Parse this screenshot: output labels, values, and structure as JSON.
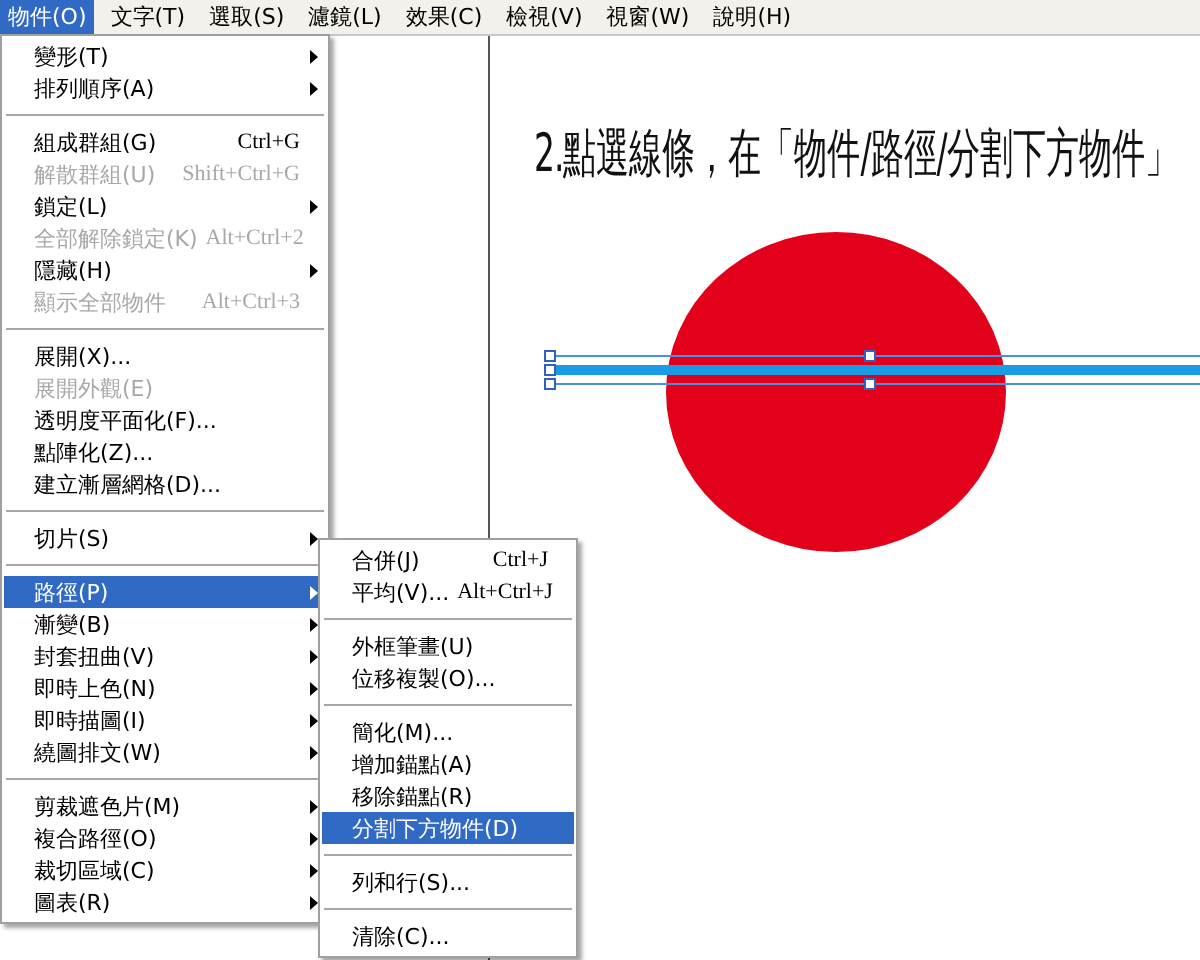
{
  "menubar": [
    {
      "label": "物件(O)",
      "selected": true
    },
    {
      "label": "文字(T)",
      "selected": false
    },
    {
      "label": "選取(S)",
      "selected": false
    },
    {
      "label": "濾鏡(L)",
      "selected": false
    },
    {
      "label": "效果(C)",
      "selected": false
    },
    {
      "label": "檢視(V)",
      "selected": false
    },
    {
      "label": "視窗(W)",
      "selected": false
    },
    {
      "label": "說明(H)",
      "selected": false
    }
  ],
  "object_menu": [
    {
      "kind": "item",
      "label": "變形(T)",
      "submenu": true,
      "disabled": false,
      "selected": false
    },
    {
      "kind": "item",
      "label": "排列順序(A)",
      "submenu": true,
      "disabled": false,
      "selected": false
    },
    {
      "kind": "separator"
    },
    {
      "kind": "item",
      "label": "組成群組(G)",
      "shortcut": "Ctrl+G",
      "submenu": false,
      "disabled": false,
      "selected": false
    },
    {
      "kind": "item",
      "label": "解散群組(U)",
      "shortcut": "Shift+Ctrl+G",
      "submenu": false,
      "disabled": true,
      "selected": false
    },
    {
      "kind": "item",
      "label": "鎖定(L)",
      "submenu": true,
      "disabled": false,
      "selected": false
    },
    {
      "kind": "item",
      "label": "全部解除鎖定(K)",
      "shortcut": "Alt+Ctrl+2",
      "submenu": false,
      "disabled": true,
      "selected": false
    },
    {
      "kind": "item",
      "label": "隱藏(H)",
      "submenu": true,
      "disabled": false,
      "selected": false
    },
    {
      "kind": "item",
      "label": "顯示全部物件",
      "shortcut": "Alt+Ctrl+3",
      "submenu": false,
      "disabled": true,
      "selected": false
    },
    {
      "kind": "separator"
    },
    {
      "kind": "item",
      "label": "展開(X)...",
      "submenu": false,
      "disabled": false,
      "selected": false
    },
    {
      "kind": "item",
      "label": "展開外觀(E)",
      "submenu": false,
      "disabled": true,
      "selected": false
    },
    {
      "kind": "item",
      "label": "透明度平面化(F)...",
      "submenu": false,
      "disabled": false,
      "selected": false
    },
    {
      "kind": "item",
      "label": "點陣化(Z)...",
      "submenu": false,
      "disabled": false,
      "selected": false
    },
    {
      "kind": "item",
      "label": "建立漸層網格(D)...",
      "submenu": false,
      "disabled": false,
      "selected": false
    },
    {
      "kind": "separator"
    },
    {
      "kind": "item",
      "label": "切片(S)",
      "submenu": true,
      "disabled": false,
      "selected": false
    },
    {
      "kind": "separator"
    },
    {
      "kind": "item",
      "label": "路徑(P)",
      "submenu": true,
      "disabled": false,
      "selected": true
    },
    {
      "kind": "item",
      "label": "漸變(B)",
      "submenu": true,
      "disabled": false,
      "selected": false
    },
    {
      "kind": "item",
      "label": "封套扭曲(V)",
      "submenu": true,
      "disabled": false,
      "selected": false
    },
    {
      "kind": "item",
      "label": "即時上色(N)",
      "submenu": true,
      "disabled": false,
      "selected": false
    },
    {
      "kind": "item",
      "label": "即時描圖(I)",
      "submenu": true,
      "disabled": false,
      "selected": false
    },
    {
      "kind": "item",
      "label": "繞圖排文(W)",
      "submenu": true,
      "disabled": false,
      "selected": false
    },
    {
      "kind": "separator"
    },
    {
      "kind": "item",
      "label": "剪裁遮色片(M)",
      "submenu": true,
      "disabled": false,
      "selected": false
    },
    {
      "kind": "item",
      "label": "複合路徑(O)",
      "submenu": true,
      "disabled": false,
      "selected": false
    },
    {
      "kind": "item",
      "label": "裁切區域(C)",
      "submenu": true,
      "disabled": false,
      "selected": false
    },
    {
      "kind": "item",
      "label": "圖表(R)",
      "submenu": true,
      "disabled": false,
      "selected": false
    }
  ],
  "path_submenu": [
    {
      "kind": "item",
      "label": "合併(J)",
      "shortcut": "Ctrl+J",
      "submenu": false,
      "disabled": false,
      "selected": false
    },
    {
      "kind": "item",
      "label": "平均(V)...",
      "shortcut": "Alt+Ctrl+J",
      "submenu": false,
      "disabled": false,
      "selected": false
    },
    {
      "kind": "separator"
    },
    {
      "kind": "item",
      "label": "外框筆畫(U)",
      "submenu": false,
      "disabled": false,
      "selected": false
    },
    {
      "kind": "item",
      "label": "位移複製(O)...",
      "submenu": false,
      "disabled": false,
      "selected": false
    },
    {
      "kind": "separator"
    },
    {
      "kind": "item",
      "label": "簡化(M)...",
      "submenu": false,
      "disabled": false,
      "selected": false
    },
    {
      "kind": "item",
      "label": "增加錨點(A)",
      "submenu": false,
      "disabled": false,
      "selected": false
    },
    {
      "kind": "item",
      "label": "移除錨點(R)",
      "submenu": false,
      "disabled": false,
      "selected": false
    },
    {
      "kind": "item",
      "label": "分割下方物件(D)",
      "submenu": false,
      "disabled": false,
      "selected": true
    },
    {
      "kind": "separator"
    },
    {
      "kind": "item",
      "label": "列和行(S)...",
      "submenu": false,
      "disabled": false,
      "selected": false
    },
    {
      "kind": "separator"
    },
    {
      "kind": "item",
      "label": "清除(C)...",
      "submenu": false,
      "disabled": false,
      "selected": false
    }
  ],
  "canvas": {
    "heading": "2.點選線條，在「物件/路徑/分割下方物件」"
  }
}
